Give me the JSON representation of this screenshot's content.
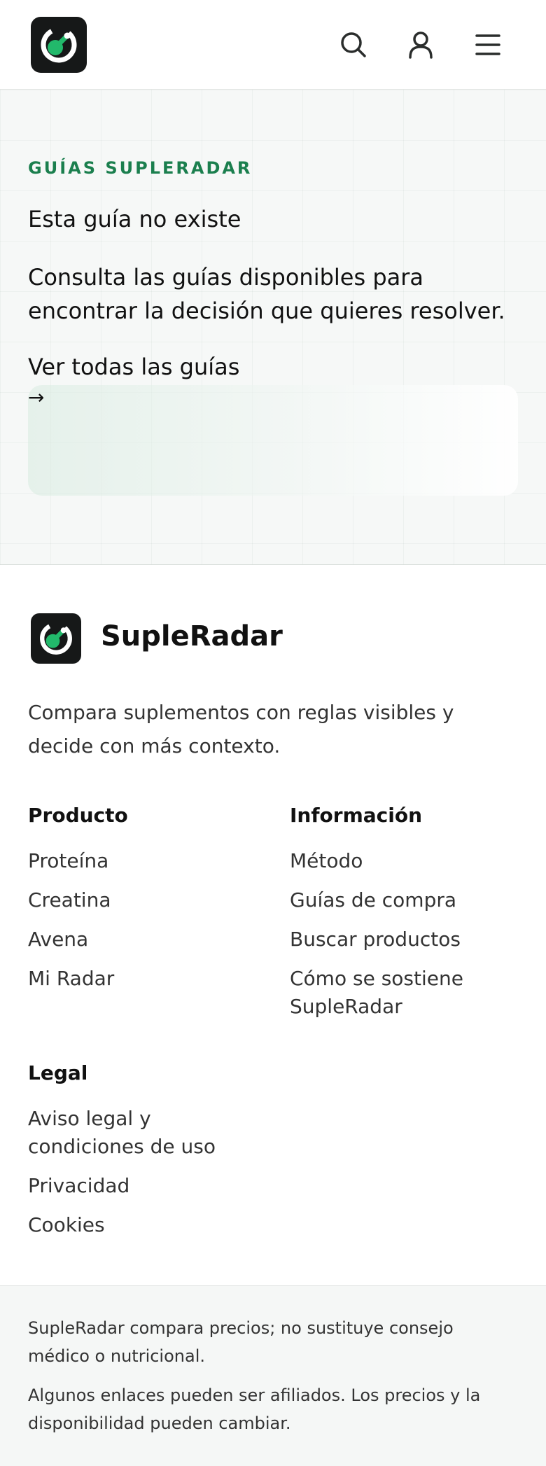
{
  "header": {
    "logo_icon": "radar-logo-icon",
    "search_icon": "search-icon",
    "account_icon": "user-icon",
    "menu_icon": "menu-icon"
  },
  "hero": {
    "eyebrow": "GUÍAS SUPLERADAR",
    "title": "Esta guía no existe",
    "description": "Consulta las guías disponibles para encontrar la decisión que quieres resolver.",
    "link_label": "Ver todas las guías",
    "arrow": "→"
  },
  "footer": {
    "brand_name": "SupleRadar",
    "description": "Compara suplementos con reglas visibles y decide con más contexto.",
    "columns": [
      {
        "heading": "Producto",
        "links": [
          "Proteína",
          "Creatina",
          "Avena",
          "Mi Radar"
        ]
      },
      {
        "heading": "Información",
        "links": [
          "Método",
          "Guías de compra",
          "Buscar productos",
          "Cómo se sostiene SupleRadar"
        ]
      },
      {
        "heading": "Legal",
        "links": [
          "Aviso legal y condiciones de uso",
          "Privacidad",
          "Cookies"
        ]
      }
    ]
  },
  "disclaimer": {
    "line1": "SupleRadar compara precios; no sustituye consejo médico o nutricional.",
    "line2": "Algunos enlaces pueden ser afiliados. Los precios y la disponibilidad pueden cambiar."
  },
  "colors": {
    "accent": "#1b7f4e",
    "logo_green": "#22b96b",
    "logo_bg": "#161818"
  }
}
